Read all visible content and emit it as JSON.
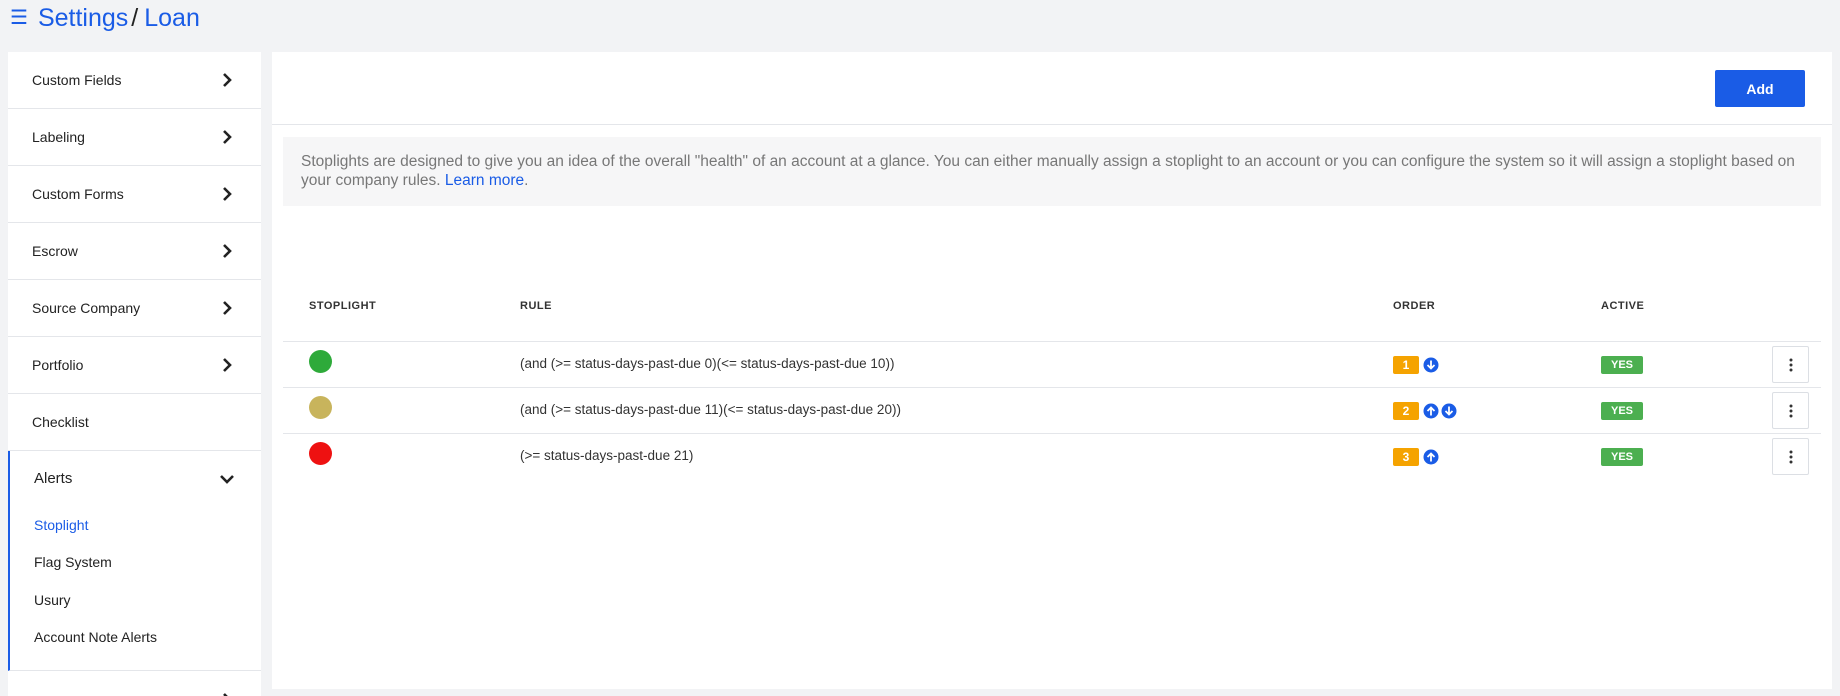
{
  "header": {
    "menu_icon": "hamburger-icon",
    "breadcrumb": [
      "Settings",
      "Loan"
    ],
    "separator": "/"
  },
  "sidebar": {
    "items": [
      {
        "label": "Custom Fields",
        "icon": "chevron-right-icon"
      },
      {
        "label": "Labeling",
        "icon": "chevron-right-icon"
      },
      {
        "label": "Custom Forms",
        "icon": "chevron-right-icon"
      },
      {
        "label": "Escrow",
        "icon": "chevron-right-icon"
      },
      {
        "label": "Source Company",
        "icon": "chevron-right-icon"
      },
      {
        "label": "Portfolio",
        "icon": "chevron-right-icon"
      },
      {
        "label": "Checklist"
      }
    ],
    "expanded_group": {
      "label": "Alerts",
      "icon": "chevron-down-icon",
      "children": [
        "Stoplight",
        "Flag System",
        "Usury",
        "Account Note Alerts"
      ],
      "active_child": "Stoplight"
    }
  },
  "main": {
    "add_label": "Add",
    "info_text": "Stoplights are designed to give you an idea of the overall \"health\" of an account at a glance. You can either manually assign a stoplight to an account or you can configure the system so it will assign a stoplight based on your company rules.",
    "learn_more": "Learn more",
    "info_end": ".",
    "table": {
      "headers": {
        "stoplight": "STOPLIGHT",
        "rule": "RULE",
        "order": "ORDER",
        "active": "ACTIVE"
      },
      "rows": [
        {
          "color": "#2eaa3a",
          "rule": "(and (>= status-days-past-due 0)(<= status-days-past-due 10))",
          "order": "1",
          "arrows": [
            "down"
          ],
          "active": "YES"
        },
        {
          "color": "#c8b45c",
          "rule": "(and (>= status-days-past-due 11)(<= status-days-past-due 20))",
          "order": "2",
          "arrows": [
            "up",
            "down"
          ],
          "active": "YES"
        },
        {
          "color": "#ee1111",
          "rule": "(>= status-days-past-due 21)",
          "order": "3",
          "arrows": [
            "up"
          ],
          "active": "YES"
        }
      ]
    }
  },
  "colors": {
    "accent": "#1a5ce6",
    "order_badge": "#f5a300",
    "active_badge": "#4caf50"
  }
}
